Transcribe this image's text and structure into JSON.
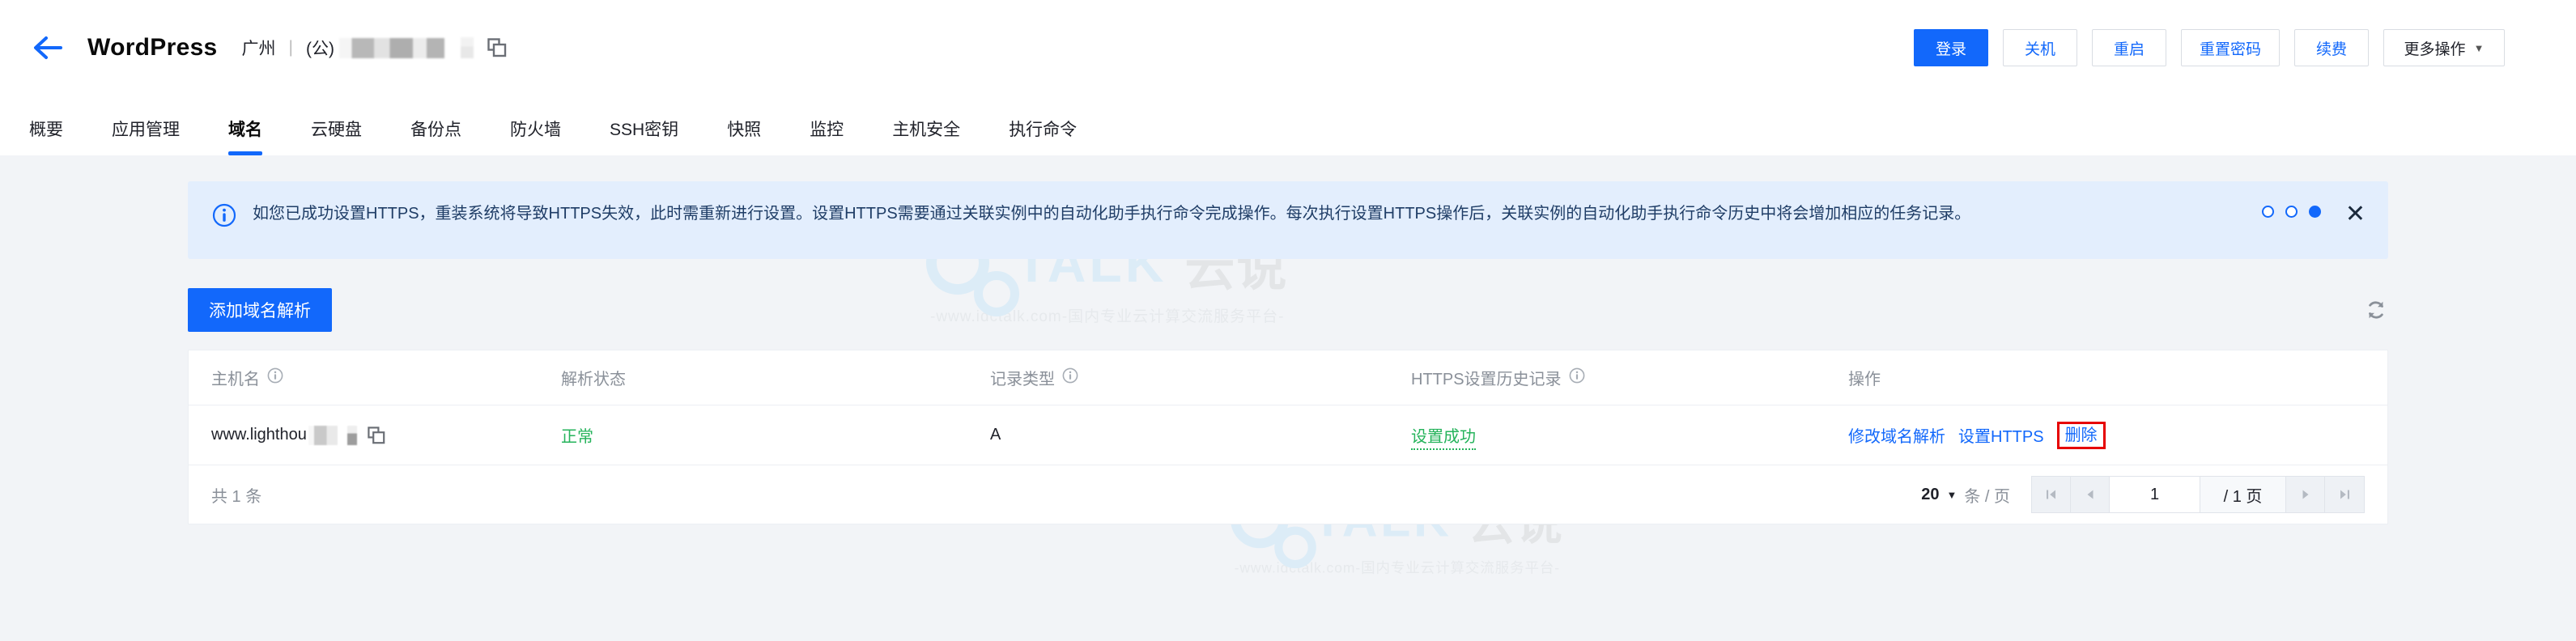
{
  "header": {
    "back_icon": "back-arrow-icon",
    "title": "WordPress",
    "region": "广州",
    "separator": "|",
    "net_type": "(公)",
    "copy_icon": "copy-icon",
    "actions": [
      {
        "label": "登录",
        "primary": true
      },
      {
        "label": "关机",
        "primary": false
      },
      {
        "label": "重启",
        "primary": false
      },
      {
        "label": "重置密码",
        "primary": false
      },
      {
        "label": "续费",
        "primary": false
      }
    ],
    "more_label": "更多操作",
    "more_caret": "▼"
  },
  "tabs": [
    {
      "label": "概要",
      "active": false
    },
    {
      "label": "应用管理",
      "active": false
    },
    {
      "label": "域名",
      "active": true
    },
    {
      "label": "云硬盘",
      "active": false
    },
    {
      "label": "备份点",
      "active": false
    },
    {
      "label": "防火墙",
      "active": false
    },
    {
      "label": "SSH密钥",
      "active": false
    },
    {
      "label": "快照",
      "active": false
    },
    {
      "label": "监控",
      "active": false
    },
    {
      "label": "主机安全",
      "active": false
    },
    {
      "label": "执行命令",
      "active": false
    }
  ],
  "notice": {
    "info_icon": "info-circle-icon",
    "text": "如您已成功设置HTTPS，重装系统将导致HTTPS失效，此时需重新进行设置。设置HTTPS需要通过关联实例中的自动化助手执行命令完成操作。每次执行设置HTTPS操作后，关联实例的自动化助手执行命令历史中将会增加相应的任务记录。",
    "dots": [
      false,
      false,
      true
    ],
    "close_icon": "close-icon"
  },
  "toolbar": {
    "add_label": "添加域名解析",
    "refresh_icon": "refresh-icon"
  },
  "table": {
    "columns": [
      {
        "label": "主机名",
        "info": true
      },
      {
        "label": "解析状态",
        "info": false
      },
      {
        "label": "记录类型",
        "info": true
      },
      {
        "label": "HTTPS设置历史记录",
        "info": true
      },
      {
        "label": "操作",
        "info": false
      }
    ],
    "rows": [
      {
        "host": "www.lighthou",
        "copy_icon": "copy-icon",
        "status": "正常",
        "record_type": "A",
        "https_history": "设置成功",
        "actions": [
          "修改域名解析",
          "设置HTTPS",
          "删除"
        ]
      }
    ]
  },
  "footer": {
    "total_text": "共 1 条",
    "page_size": "20",
    "page_size_caret": "▼",
    "per_page_label": "条 / 页",
    "first_icon": "first-page-icon",
    "prev_icon": "prev-page-icon",
    "current_page": "1",
    "total_pages": "/ 1 页",
    "next_icon": "next-page-icon",
    "last_icon": "last-page-icon"
  },
  "watermark": {
    "brand": "TALK",
    "brand_cn": "云说",
    "sub": "-www.idctalk.com-国内专业云计算交流服务平台-"
  },
  "colors": {
    "accent": "#1268fb",
    "success": "#25b35b",
    "danger": "#e60000",
    "notice_bg": "#e3eefd"
  }
}
